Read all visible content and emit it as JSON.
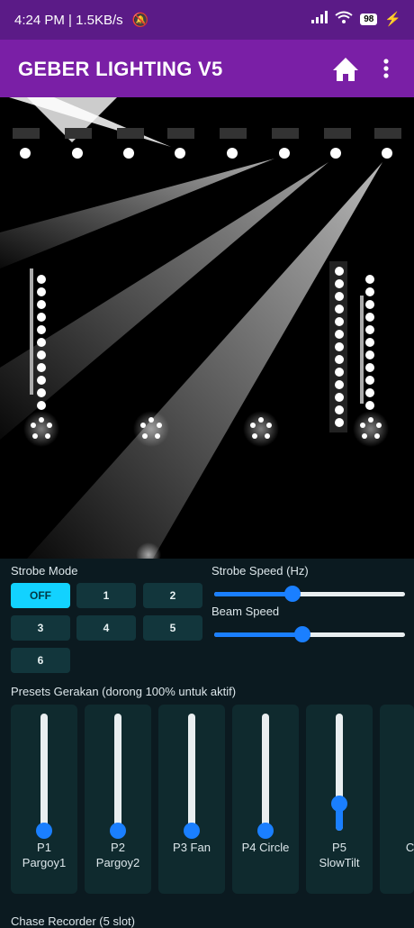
{
  "status_bar": {
    "time": "4:24 PM",
    "speed": "1.5KB/s",
    "battery": "98"
  },
  "app_bar": {
    "title": "GEBER LIGHTING V5"
  },
  "strobe": {
    "mode_label": "Strobe Mode",
    "buttons": [
      "OFF",
      "1",
      "2",
      "3",
      "4",
      "5",
      "6"
    ],
    "speed_label": "Strobe Speed (Hz)",
    "speed_value": 0.4,
    "beam_label": "Beam Speed",
    "beam_value": 0.46
  },
  "presets": {
    "label": "Presets Gerakan (dorong 100% untuk aktif)",
    "items": [
      {
        "line1": "P1",
        "line2": "Pargoy1",
        "value": 0
      },
      {
        "line1": "P2",
        "line2": "Pargoy2",
        "value": 0
      },
      {
        "line1": "P3 Fan",
        "line2": "",
        "value": 0
      },
      {
        "line1": "P4 Circle",
        "line2": "",
        "value": 0
      },
      {
        "line1": "P5",
        "line2": "SlowTilt",
        "value": 0.23
      },
      {
        "line1": "",
        "line2": "Ci",
        "value": 0
      }
    ]
  },
  "footer": {
    "label": "Chase Recorder (5 slot)"
  },
  "colors": {
    "accent": "#1a7fff",
    "active": "#12d2ff",
    "appbar": "#7a1fa6",
    "statusbar": "#5b1b87"
  }
}
